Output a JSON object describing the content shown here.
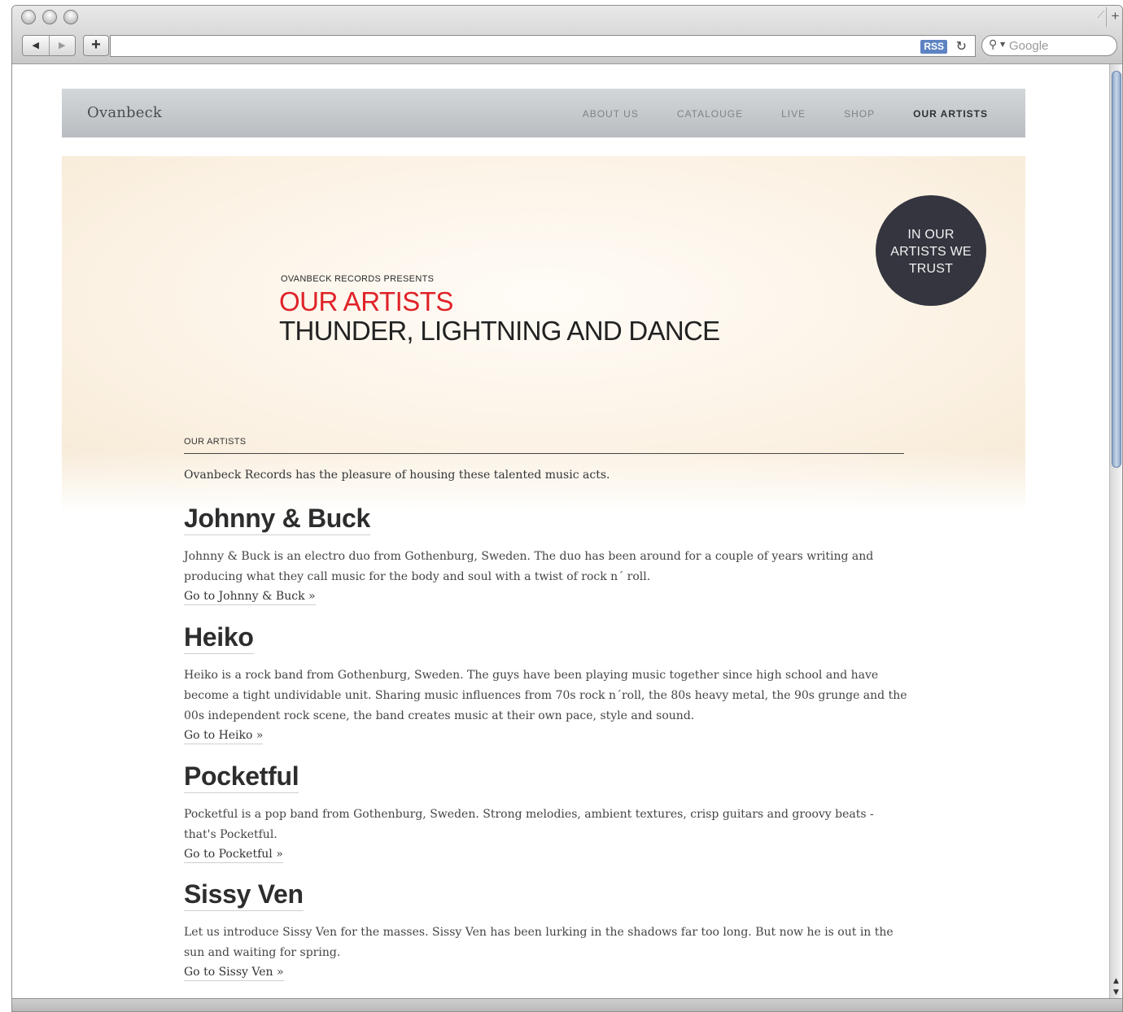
{
  "browser": {
    "new_tab": "+",
    "back": "◀",
    "forward": "▶",
    "add": "+",
    "rss": "RSS",
    "reload": "↻",
    "search_placeholder": "Google",
    "search_icon": "magnifier-icon"
  },
  "site": {
    "logo": "Ovanbeck",
    "nav": [
      {
        "label": "ABOUT US"
      },
      {
        "label": "CATALOUGE"
      },
      {
        "label": "LIVE"
      },
      {
        "label": "SHOP"
      },
      {
        "label": "OUR ARTISTS",
        "active": true
      }
    ]
  },
  "hero": {
    "presents": "OVANBECK RECORDS PRESENTS",
    "title": "OUR ARTISTS",
    "subtitle": "THUNDER, LIGHTNING AND DANCE",
    "badge_lines": [
      "IN OUR",
      "ARTISTS WE",
      "TRUST"
    ],
    "title_color": "#e02228",
    "badge_color": "#34353f"
  },
  "section": {
    "label": "OUR ARTISTS",
    "intro": "Ovanbeck Records has the pleasure of housing these talented music acts."
  },
  "artists": [
    {
      "name": "Johnny & Buck",
      "description": "Johnny & Buck is an electro duo from Gothenburg, Sweden. The duo has been around for a couple of years writing and producing what they call music for the body and soul with a twist of rock n´ roll.",
      "link": "Go to Johnny & Buck »"
    },
    {
      "name": "Heiko",
      "description": "Heiko is a rock band from Gothenburg, Sweden. The guys have been playing music together since high school and have become a tight undividable unit. Sharing music influences from 70s rock n´roll, the 80s heavy metal, the 90s grunge and the 00s independent rock scene, the band creates music at their own pace, style and sound.",
      "link": "Go to Heiko »"
    },
    {
      "name": "Pocketful",
      "description": "Pocketful is a pop band from Gothenburg, Sweden. Strong melodies, ambient textures, crisp guitars and groovy beats - that's Pocketful.",
      "link": "Go to Pocketful »"
    },
    {
      "name": "Sissy Ven",
      "description": "Let us introduce Sissy Ven for the masses. Sissy Ven has been lurking in the shadows far too long. But now he is out in the sun and waiting for spring.",
      "link": "Go to Sissy Ven »"
    }
  ]
}
